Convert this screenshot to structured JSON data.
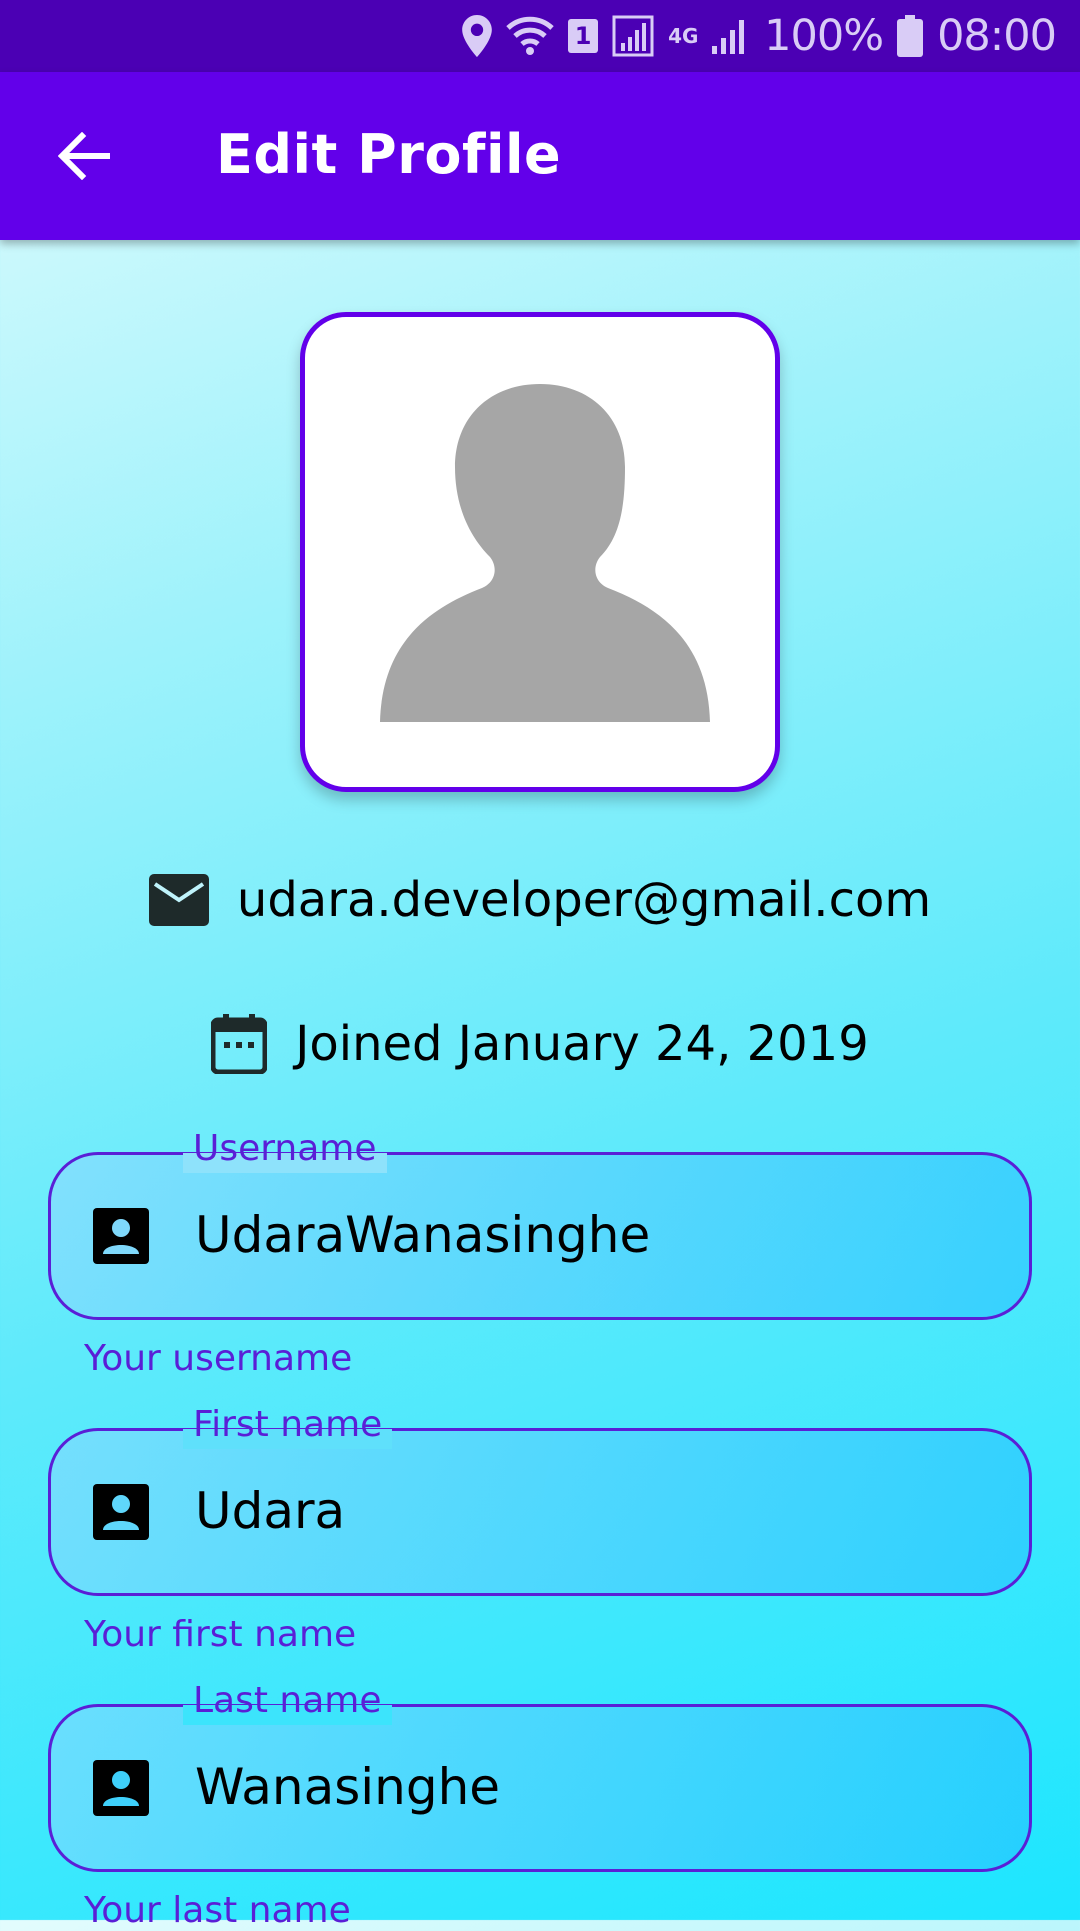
{
  "status_bar": {
    "battery": "100%",
    "time": "08:00",
    "sim_slot": "1",
    "network": "4G"
  },
  "app_bar": {
    "title": "Edit Profile",
    "back_icon": "arrow-back-icon"
  },
  "profile": {
    "avatar_icon": "person-placeholder-icon",
    "email": "udara.developer@gmail.com",
    "email_icon": "email-icon",
    "joined": "Joined January 24, 2019",
    "joined_icon": "calendar-icon"
  },
  "fields": [
    {
      "label": "Username",
      "value": "UdaraWanasinghe",
      "helper": "Your username",
      "icon": "account-box-icon"
    },
    {
      "label": "First name",
      "value": "Udara",
      "helper": "Your first name",
      "icon": "account-box-icon"
    },
    {
      "label": "Last name",
      "value": "Wanasinghe",
      "helper": "Your last name",
      "icon": "account-box-icon"
    }
  ],
  "colors": {
    "primary": "#6200ea",
    "status_bar": "#4b00b4",
    "outline": "#5a1fd6",
    "avatar_gray": "#a6a6a6"
  }
}
